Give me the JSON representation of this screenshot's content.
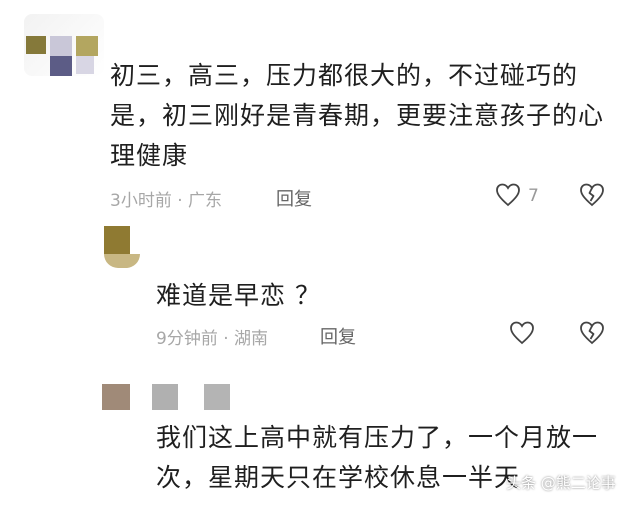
{
  "comments": [
    {
      "lines": [
        "初三，高三，压力都很大的，不过碰巧的",
        "是，初三刚好是青春期，更要注意孩子的心",
        "理健康"
      ],
      "meta": "3小时前 · 广东",
      "reply_label": "回复",
      "like_count": "7",
      "like_icon": "heart-icon",
      "dislike_icon": "broken-heart-icon"
    },
    {
      "lines": [
        "难道是早恋 ？"
      ],
      "meta": "9分钟前 · 湖南",
      "reply_label": "回复",
      "like_icon": "heart-icon",
      "dislike_icon": "broken-heart-icon"
    },
    {
      "lines": [
        "我们这上高中就有压力了，一个月放一",
        "次，星期天只在学校休息一半天"
      ]
    }
  ],
  "watermark": "头条 @熊二论事",
  "colors": {
    "meta_text": "#a7a7a7",
    "reply_text": "#666666",
    "icon_stroke": "#444444"
  }
}
